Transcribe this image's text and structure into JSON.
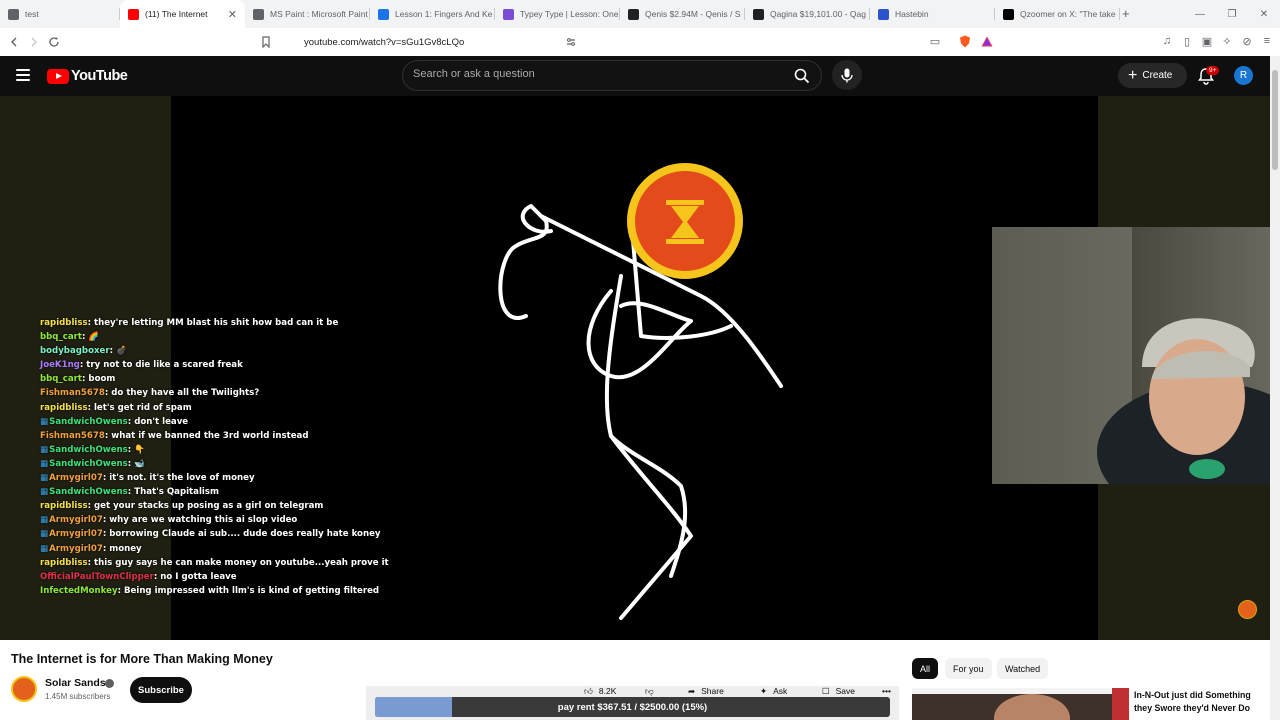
{
  "browser": {
    "tabs": [
      {
        "title": "test",
        "active": false
      },
      {
        "title": "(11) The Internet",
        "active": true
      },
      {
        "title": "MS Paint : Microsoft Paint",
        "active": false
      },
      {
        "title": "Lesson 1: Fingers And Ke",
        "active": false
      },
      {
        "title": "Typey Type | Lesson: One",
        "active": false
      },
      {
        "title": "Qenis $2.94M - Qenis / S",
        "active": false
      },
      {
        "title": "Qagina $19,101.00 - Qag",
        "active": false
      },
      {
        "title": "Hastebin",
        "active": false
      },
      {
        "title": "Qzoomer on X: \"The take",
        "active": false
      }
    ],
    "new_tab": "+",
    "url": "youtube.com/watch?v=sGu1Gv8cLQo"
  },
  "header": {
    "logo_text": "YouTube",
    "search_placeholder": "Search or ask a question",
    "create_label": "Create",
    "notif_badge": "9+",
    "avatar_letter": "R"
  },
  "chat": [
    {
      "user": "rapidbliss",
      "color": "#f4e04d",
      "msg": "they're letting MM blast his shit how bad can it be",
      "badge": false
    },
    {
      "user": "bbq_cart",
      "color": "#8fe83a",
      "msg": "🌈",
      "badge": false
    },
    {
      "user": "bodybagboxer",
      "color": "#7cf0c4",
      "msg": "💣",
      "badge": false
    },
    {
      "user": "JoeK1ng",
      "color": "#a97cff",
      "msg": "try not to die like a scared freak",
      "badge": false
    },
    {
      "user": "bbq_cart",
      "color": "#8fe83a",
      "msg": "boom",
      "badge": false
    },
    {
      "user": "Fishman5678",
      "color": "#f0a040",
      "msg": "do they have all the Twilights?",
      "badge": false
    },
    {
      "user": "rapidbliss",
      "color": "#f4e04d",
      "msg": "let's get rid of spam",
      "badge": false
    },
    {
      "user": "SandwichOwens",
      "color": "#3ee07a",
      "msg": "don't leave",
      "badge": true
    },
    {
      "user": "Fishman5678",
      "color": "#f0a040",
      "msg": "what if we banned the 3rd world instead",
      "badge": false
    },
    {
      "user": "SandwichOwens",
      "color": "#3ee07a",
      "msg": "👇",
      "badge": true
    },
    {
      "user": "SandwichOwens",
      "color": "#3ee07a",
      "msg": "🐋",
      "badge": true
    },
    {
      "user": "Armygirl07",
      "color": "#f0a040",
      "msg": "it's not. it's the love of money",
      "badge": true
    },
    {
      "user": "SandwichOwens",
      "color": "#3ee07a",
      "msg": "That's Qapitalism",
      "badge": true
    },
    {
      "user": "rapidbliss",
      "color": "#f4e04d",
      "msg": "get your stacks up posing as a girl on telegram",
      "badge": false
    },
    {
      "user": "Armygirl07",
      "color": "#f0a040",
      "msg": "why are we watching this ai slop video",
      "badge": true
    },
    {
      "user": "Armygirl07",
      "color": "#f0a040",
      "msg": "borrowing Claude ai sub.... dude does really hate koney",
      "badge": true
    },
    {
      "user": "Armygirl07",
      "color": "#f0a040",
      "msg": "money",
      "badge": true
    },
    {
      "user": "rapidbliss",
      "color": "#f4e04d",
      "msg": "this guy says he can make money on youtube...yeah prove it",
      "badge": false
    },
    {
      "user": "OfficialPaulTownClipper",
      "color": "#e0304a",
      "msg": "no I gotta leave",
      "badge": false
    },
    {
      "user": "InfectedMonkey",
      "color": "#8fe83a",
      "msg": "Being impressed with llm's is kind of getting filtered",
      "badge": false
    }
  ],
  "video": {
    "title": "The Internet is for More Than Making Money",
    "channel": "Solar Sands",
    "subscribers": "1.45M subscribers",
    "subscribe_label": "Subscribe",
    "likes": "8.2K",
    "share_label": "Share",
    "ask_label": "Ask",
    "save_label": "Save",
    "more_label": "•••"
  },
  "goal": {
    "text": "pay rent $367.51 / $2500.00 (15%)",
    "progress": 0.15
  },
  "chips": [
    "All",
    "For you",
    "Watched"
  ],
  "recommendation": {
    "title": "In-N-Out just did Something they Swore they'd Never Do"
  },
  "colors": {
    "yt_red": "#ff0000",
    "player_bg": "#1f1f12",
    "brand_orange": "#e3611a",
    "brand_gold": "#f3c318"
  }
}
